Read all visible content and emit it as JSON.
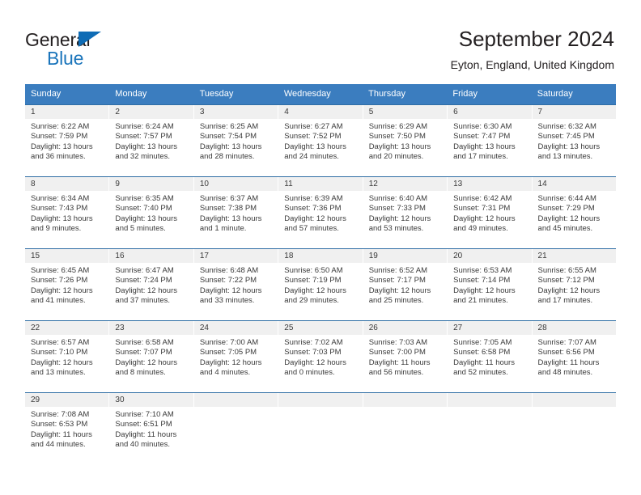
{
  "logo": {
    "word_one": "General",
    "word_two": "Blue",
    "triangle_color": "#0f6cb5",
    "blue_color": "#1b75bb",
    "dark_color": "#231f20"
  },
  "header": {
    "title": "September 2024",
    "location": "Eyton, England, United Kingdom"
  },
  "theme": {
    "header_bg": "#3b7dbf",
    "row_border": "#2f6ea5",
    "day_band_bg": "#f0f0f0",
    "text": "#3a3a3a"
  },
  "weekdays": [
    "Sunday",
    "Monday",
    "Tuesday",
    "Wednesday",
    "Thursday",
    "Friday",
    "Saturday"
  ],
  "weeks": [
    [
      {
        "day": "1",
        "sunrise": "Sunrise: 6:22 AM",
        "sunset": "Sunset: 7:59 PM",
        "daylight_line1": "Daylight: 13 hours",
        "daylight_line2": "and 36 minutes."
      },
      {
        "day": "2",
        "sunrise": "Sunrise: 6:24 AM",
        "sunset": "Sunset: 7:57 PM",
        "daylight_line1": "Daylight: 13 hours",
        "daylight_line2": "and 32 minutes."
      },
      {
        "day": "3",
        "sunrise": "Sunrise: 6:25 AM",
        "sunset": "Sunset: 7:54 PM",
        "daylight_line1": "Daylight: 13 hours",
        "daylight_line2": "and 28 minutes."
      },
      {
        "day": "4",
        "sunrise": "Sunrise: 6:27 AM",
        "sunset": "Sunset: 7:52 PM",
        "daylight_line1": "Daylight: 13 hours",
        "daylight_line2": "and 24 minutes."
      },
      {
        "day": "5",
        "sunrise": "Sunrise: 6:29 AM",
        "sunset": "Sunset: 7:50 PM",
        "daylight_line1": "Daylight: 13 hours",
        "daylight_line2": "and 20 minutes."
      },
      {
        "day": "6",
        "sunrise": "Sunrise: 6:30 AM",
        "sunset": "Sunset: 7:47 PM",
        "daylight_line1": "Daylight: 13 hours",
        "daylight_line2": "and 17 minutes."
      },
      {
        "day": "7",
        "sunrise": "Sunrise: 6:32 AM",
        "sunset": "Sunset: 7:45 PM",
        "daylight_line1": "Daylight: 13 hours",
        "daylight_line2": "and 13 minutes."
      }
    ],
    [
      {
        "day": "8",
        "sunrise": "Sunrise: 6:34 AM",
        "sunset": "Sunset: 7:43 PM",
        "daylight_line1": "Daylight: 13 hours",
        "daylight_line2": "and 9 minutes."
      },
      {
        "day": "9",
        "sunrise": "Sunrise: 6:35 AM",
        "sunset": "Sunset: 7:40 PM",
        "daylight_line1": "Daylight: 13 hours",
        "daylight_line2": "and 5 minutes."
      },
      {
        "day": "10",
        "sunrise": "Sunrise: 6:37 AM",
        "sunset": "Sunset: 7:38 PM",
        "daylight_line1": "Daylight: 13 hours",
        "daylight_line2": "and 1 minute."
      },
      {
        "day": "11",
        "sunrise": "Sunrise: 6:39 AM",
        "sunset": "Sunset: 7:36 PM",
        "daylight_line1": "Daylight: 12 hours",
        "daylight_line2": "and 57 minutes."
      },
      {
        "day": "12",
        "sunrise": "Sunrise: 6:40 AM",
        "sunset": "Sunset: 7:33 PM",
        "daylight_line1": "Daylight: 12 hours",
        "daylight_line2": "and 53 minutes."
      },
      {
        "day": "13",
        "sunrise": "Sunrise: 6:42 AM",
        "sunset": "Sunset: 7:31 PM",
        "daylight_line1": "Daylight: 12 hours",
        "daylight_line2": "and 49 minutes."
      },
      {
        "day": "14",
        "sunrise": "Sunrise: 6:44 AM",
        "sunset": "Sunset: 7:29 PM",
        "daylight_line1": "Daylight: 12 hours",
        "daylight_line2": "and 45 minutes."
      }
    ],
    [
      {
        "day": "15",
        "sunrise": "Sunrise: 6:45 AM",
        "sunset": "Sunset: 7:26 PM",
        "daylight_line1": "Daylight: 12 hours",
        "daylight_line2": "and 41 minutes."
      },
      {
        "day": "16",
        "sunrise": "Sunrise: 6:47 AM",
        "sunset": "Sunset: 7:24 PM",
        "daylight_line1": "Daylight: 12 hours",
        "daylight_line2": "and 37 minutes."
      },
      {
        "day": "17",
        "sunrise": "Sunrise: 6:48 AM",
        "sunset": "Sunset: 7:22 PM",
        "daylight_line1": "Daylight: 12 hours",
        "daylight_line2": "and 33 minutes."
      },
      {
        "day": "18",
        "sunrise": "Sunrise: 6:50 AM",
        "sunset": "Sunset: 7:19 PM",
        "daylight_line1": "Daylight: 12 hours",
        "daylight_line2": "and 29 minutes."
      },
      {
        "day": "19",
        "sunrise": "Sunrise: 6:52 AM",
        "sunset": "Sunset: 7:17 PM",
        "daylight_line1": "Daylight: 12 hours",
        "daylight_line2": "and 25 minutes."
      },
      {
        "day": "20",
        "sunrise": "Sunrise: 6:53 AM",
        "sunset": "Sunset: 7:14 PM",
        "daylight_line1": "Daylight: 12 hours",
        "daylight_line2": "and 21 minutes."
      },
      {
        "day": "21",
        "sunrise": "Sunrise: 6:55 AM",
        "sunset": "Sunset: 7:12 PM",
        "daylight_line1": "Daylight: 12 hours",
        "daylight_line2": "and 17 minutes."
      }
    ],
    [
      {
        "day": "22",
        "sunrise": "Sunrise: 6:57 AM",
        "sunset": "Sunset: 7:10 PM",
        "daylight_line1": "Daylight: 12 hours",
        "daylight_line2": "and 13 minutes."
      },
      {
        "day": "23",
        "sunrise": "Sunrise: 6:58 AM",
        "sunset": "Sunset: 7:07 PM",
        "daylight_line1": "Daylight: 12 hours",
        "daylight_line2": "and 8 minutes."
      },
      {
        "day": "24",
        "sunrise": "Sunrise: 7:00 AM",
        "sunset": "Sunset: 7:05 PM",
        "daylight_line1": "Daylight: 12 hours",
        "daylight_line2": "and 4 minutes."
      },
      {
        "day": "25",
        "sunrise": "Sunrise: 7:02 AM",
        "sunset": "Sunset: 7:03 PM",
        "daylight_line1": "Daylight: 12 hours",
        "daylight_line2": "and 0 minutes."
      },
      {
        "day": "26",
        "sunrise": "Sunrise: 7:03 AM",
        "sunset": "Sunset: 7:00 PM",
        "daylight_line1": "Daylight: 11 hours",
        "daylight_line2": "and 56 minutes."
      },
      {
        "day": "27",
        "sunrise": "Sunrise: 7:05 AM",
        "sunset": "Sunset: 6:58 PM",
        "daylight_line1": "Daylight: 11 hours",
        "daylight_line2": "and 52 minutes."
      },
      {
        "day": "28",
        "sunrise": "Sunrise: 7:07 AM",
        "sunset": "Sunset: 6:56 PM",
        "daylight_line1": "Daylight: 11 hours",
        "daylight_line2": "and 48 minutes."
      }
    ],
    [
      {
        "day": "29",
        "sunrise": "Sunrise: 7:08 AM",
        "sunset": "Sunset: 6:53 PM",
        "daylight_line1": "Daylight: 11 hours",
        "daylight_line2": "and 44 minutes."
      },
      {
        "day": "30",
        "sunrise": "Sunrise: 7:10 AM",
        "sunset": "Sunset: 6:51 PM",
        "daylight_line1": "Daylight: 11 hours",
        "daylight_line2": "and 40 minutes."
      },
      {
        "day": "",
        "sunrise": "",
        "sunset": "",
        "daylight_line1": "",
        "daylight_line2": ""
      },
      {
        "day": "",
        "sunrise": "",
        "sunset": "",
        "daylight_line1": "",
        "daylight_line2": ""
      },
      {
        "day": "",
        "sunrise": "",
        "sunset": "",
        "daylight_line1": "",
        "daylight_line2": ""
      },
      {
        "day": "",
        "sunrise": "",
        "sunset": "",
        "daylight_line1": "",
        "daylight_line2": ""
      },
      {
        "day": "",
        "sunrise": "",
        "sunset": "",
        "daylight_line1": "",
        "daylight_line2": ""
      }
    ]
  ]
}
